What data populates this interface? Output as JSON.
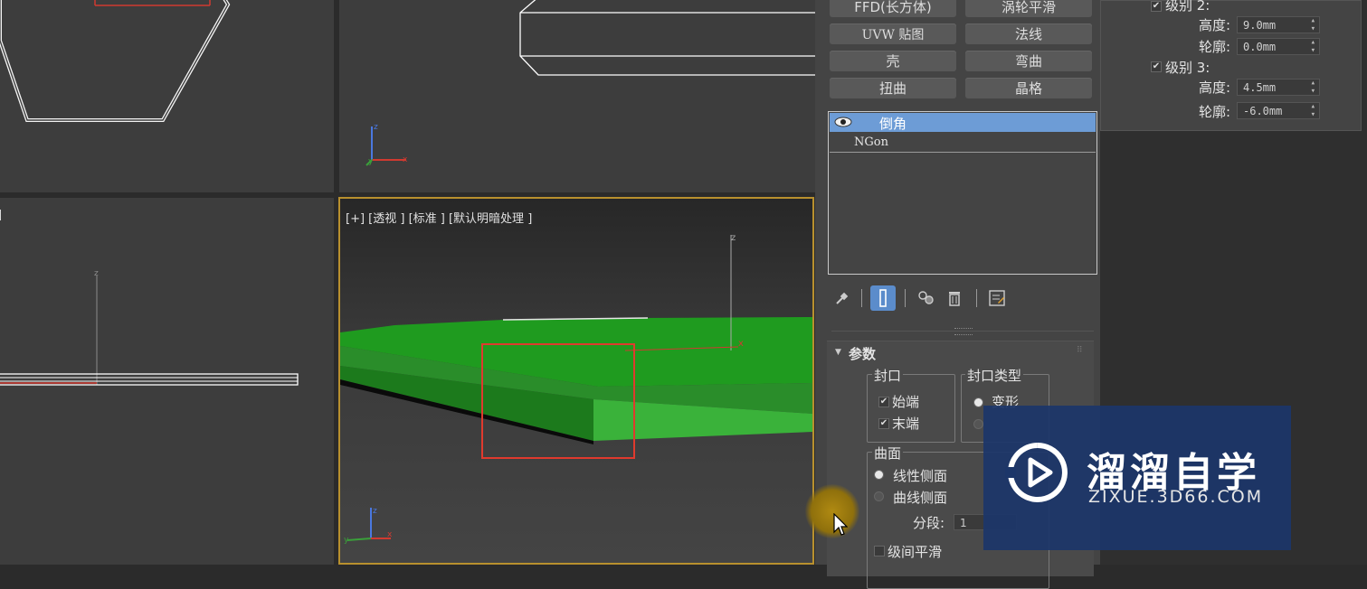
{
  "viewports": {
    "left_label": "]",
    "perspective_label": "[+] [透视 ] [标准 ] [默认明暗处理 ]",
    "axis_x": "x",
    "axis_y": "y",
    "axis_z": "z"
  },
  "modifier_buttons": [
    {
      "label": "FFD(长方体)"
    },
    {
      "label": "涡轮平滑"
    },
    {
      "label": "UVW 贴图"
    },
    {
      "label": "法线"
    },
    {
      "label": "壳"
    },
    {
      "label": "弯曲"
    },
    {
      "label": "扭曲"
    },
    {
      "label": "晶格"
    }
  ],
  "modifier_stack": {
    "selected": "倒角",
    "base": "NGon"
  },
  "stack_tools": [
    "pin-icon",
    "show-end-result-icon",
    "make-unique-icon",
    "remove-modifier-icon",
    "configure-sets-icon"
  ],
  "params": {
    "title": "参数",
    "cap_group": "封口",
    "cap_start": "始端",
    "cap_end": "末端",
    "cap_type_group": "封口类型",
    "cap_type_morph": "变形",
    "surface_group": "曲面",
    "linear_sides": "线性侧面",
    "curved_sides": "曲线侧面",
    "segments_label": "分段:",
    "segments_value": "1",
    "smooth_across_levels": "级间平滑"
  },
  "bevel_levels": {
    "level2_label": "级别 2:",
    "level2_height_label": "高度:",
    "level2_height": "9.0mm",
    "level2_outline_label": "轮廓:",
    "level2_outline": "0.0mm",
    "level3_label": "级别 3:",
    "level3_height_label": "高度:",
    "level3_height": "4.5mm",
    "level3_outline_label": "轮廓:",
    "level3_outline": "-6.0mm"
  },
  "watermark": {
    "title": "溜溜自学",
    "url": "ZIXUE.3D66.COM"
  },
  "colors": {
    "selection_blue": "#6d9cd6",
    "active_viewport_border": "#b8902e",
    "object_green": "#22a022",
    "highlight_box_red": "#e03a2e",
    "watermark_bg": "#1c3669"
  }
}
